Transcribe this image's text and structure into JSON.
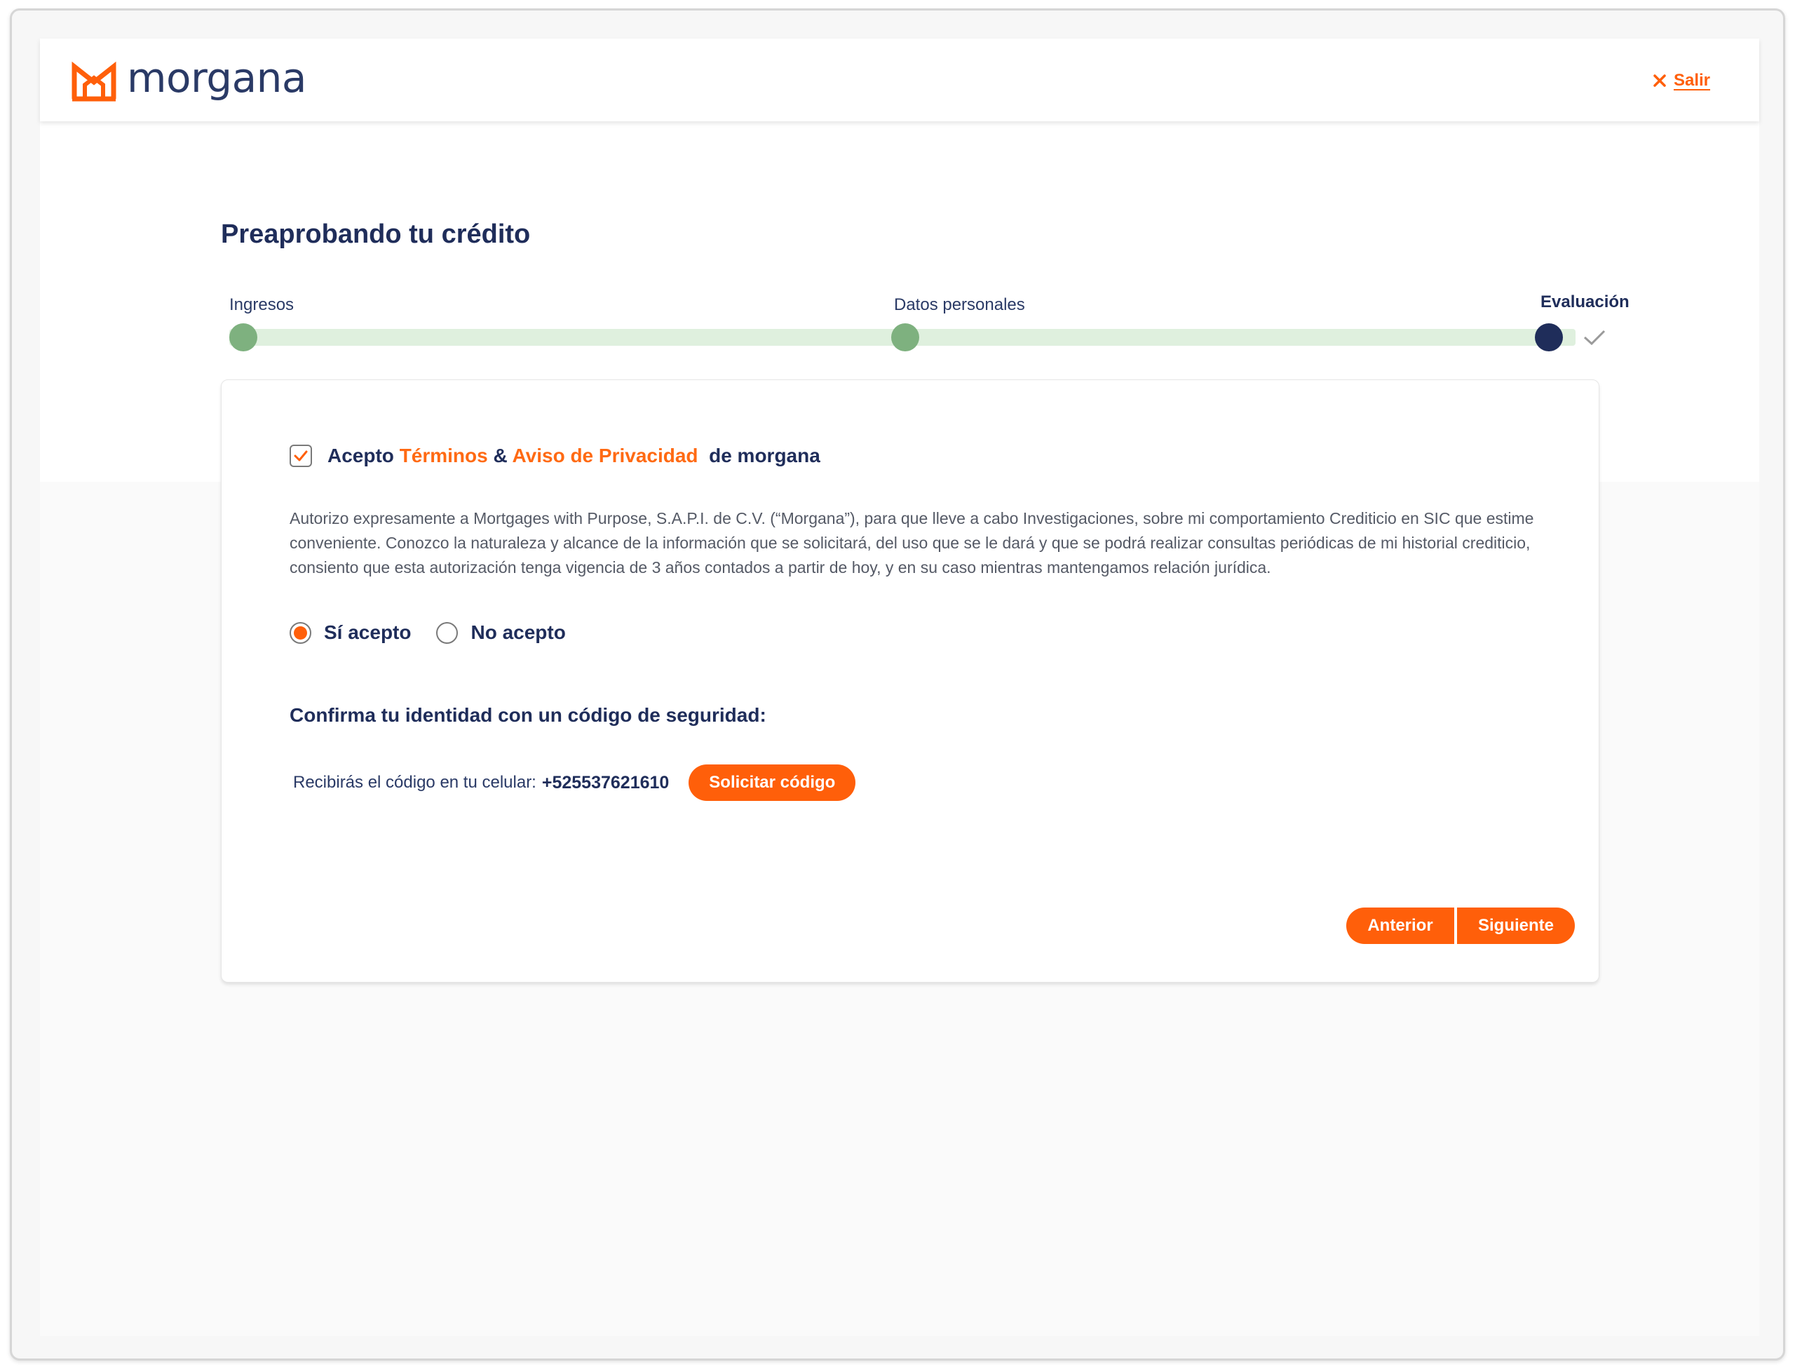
{
  "brand": {
    "name": "morgana",
    "accent_color": "#ff5f0a",
    "navy_color": "#1f2d5a"
  },
  "header": {
    "exit_label": "Salir",
    "exit_icon": "close-icon"
  },
  "page": {
    "title": "Preaprobando tu crédito"
  },
  "stepper": {
    "steps": [
      {
        "label": "Ingresos",
        "status": "done"
      },
      {
        "label": "Datos personales",
        "status": "done"
      },
      {
        "label": "Evaluación",
        "status": "current"
      }
    ],
    "completion_icon": "check-icon"
  },
  "consent": {
    "checked": true,
    "prefix": "Acepto ",
    "terms_link": "Términos",
    "ampersand": " & ",
    "privacy_link": "Aviso de Privacidad",
    "suffix": "  de morgana",
    "legal_text": "Autorizo expresamente a Mortgages with Purpose, S.A.P.I. de C.V. (“Morgana”), para que lleve a cabo Investigaciones, sobre mi comportamiento Crediticio en SIC que estime conveniente. Conozco la naturaleza y alcance de la información que se solicitará, del uso que se le dará y que se podrá realizar consultas periódicas de mi historial crediticio, consiento que esta autorización tenga vigencia de 3 años contados a partir de hoy, y en su caso mientras mantengamos relación jurídica.",
    "options": [
      {
        "label": "Sí acepto",
        "selected": true
      },
      {
        "label": "No acepto",
        "selected": false
      }
    ]
  },
  "security": {
    "title": "Confirma tu identidad con un código de seguridad:",
    "phone_text": "Recibirás el código en tu celular:",
    "phone_number": "+525537621610",
    "request_button": "Solicitar código"
  },
  "navigation": {
    "previous_label": "Anterior",
    "next_label": "Siguiente"
  }
}
